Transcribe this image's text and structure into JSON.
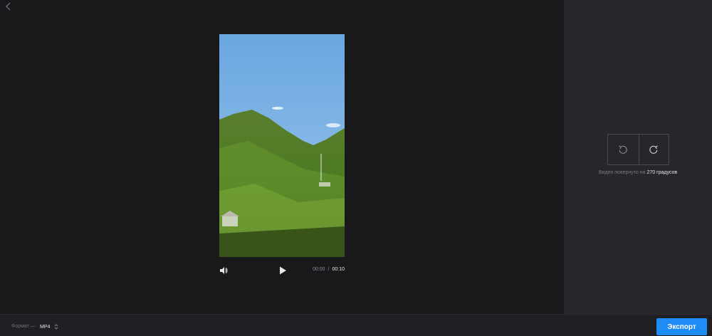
{
  "nav": {
    "back_icon": "chevron-left-icon"
  },
  "player": {
    "volume_icon": "volume-icon",
    "play_icon": "play-icon",
    "current_time": "00:00",
    "separator": "/",
    "duration": "00:10"
  },
  "rotate": {
    "left_icon": "rotate-left-icon",
    "right_icon": "rotate-right-icon",
    "info_prefix": "Видео повернуто на",
    "info_value": "270 градусов"
  },
  "footer": {
    "format_label": "Формат —",
    "format_value": "MP4",
    "export_label": "Экспорт"
  },
  "colors": {
    "accent": "#1f8bf5",
    "background": "#19191c",
    "panel": "#26262b"
  }
}
